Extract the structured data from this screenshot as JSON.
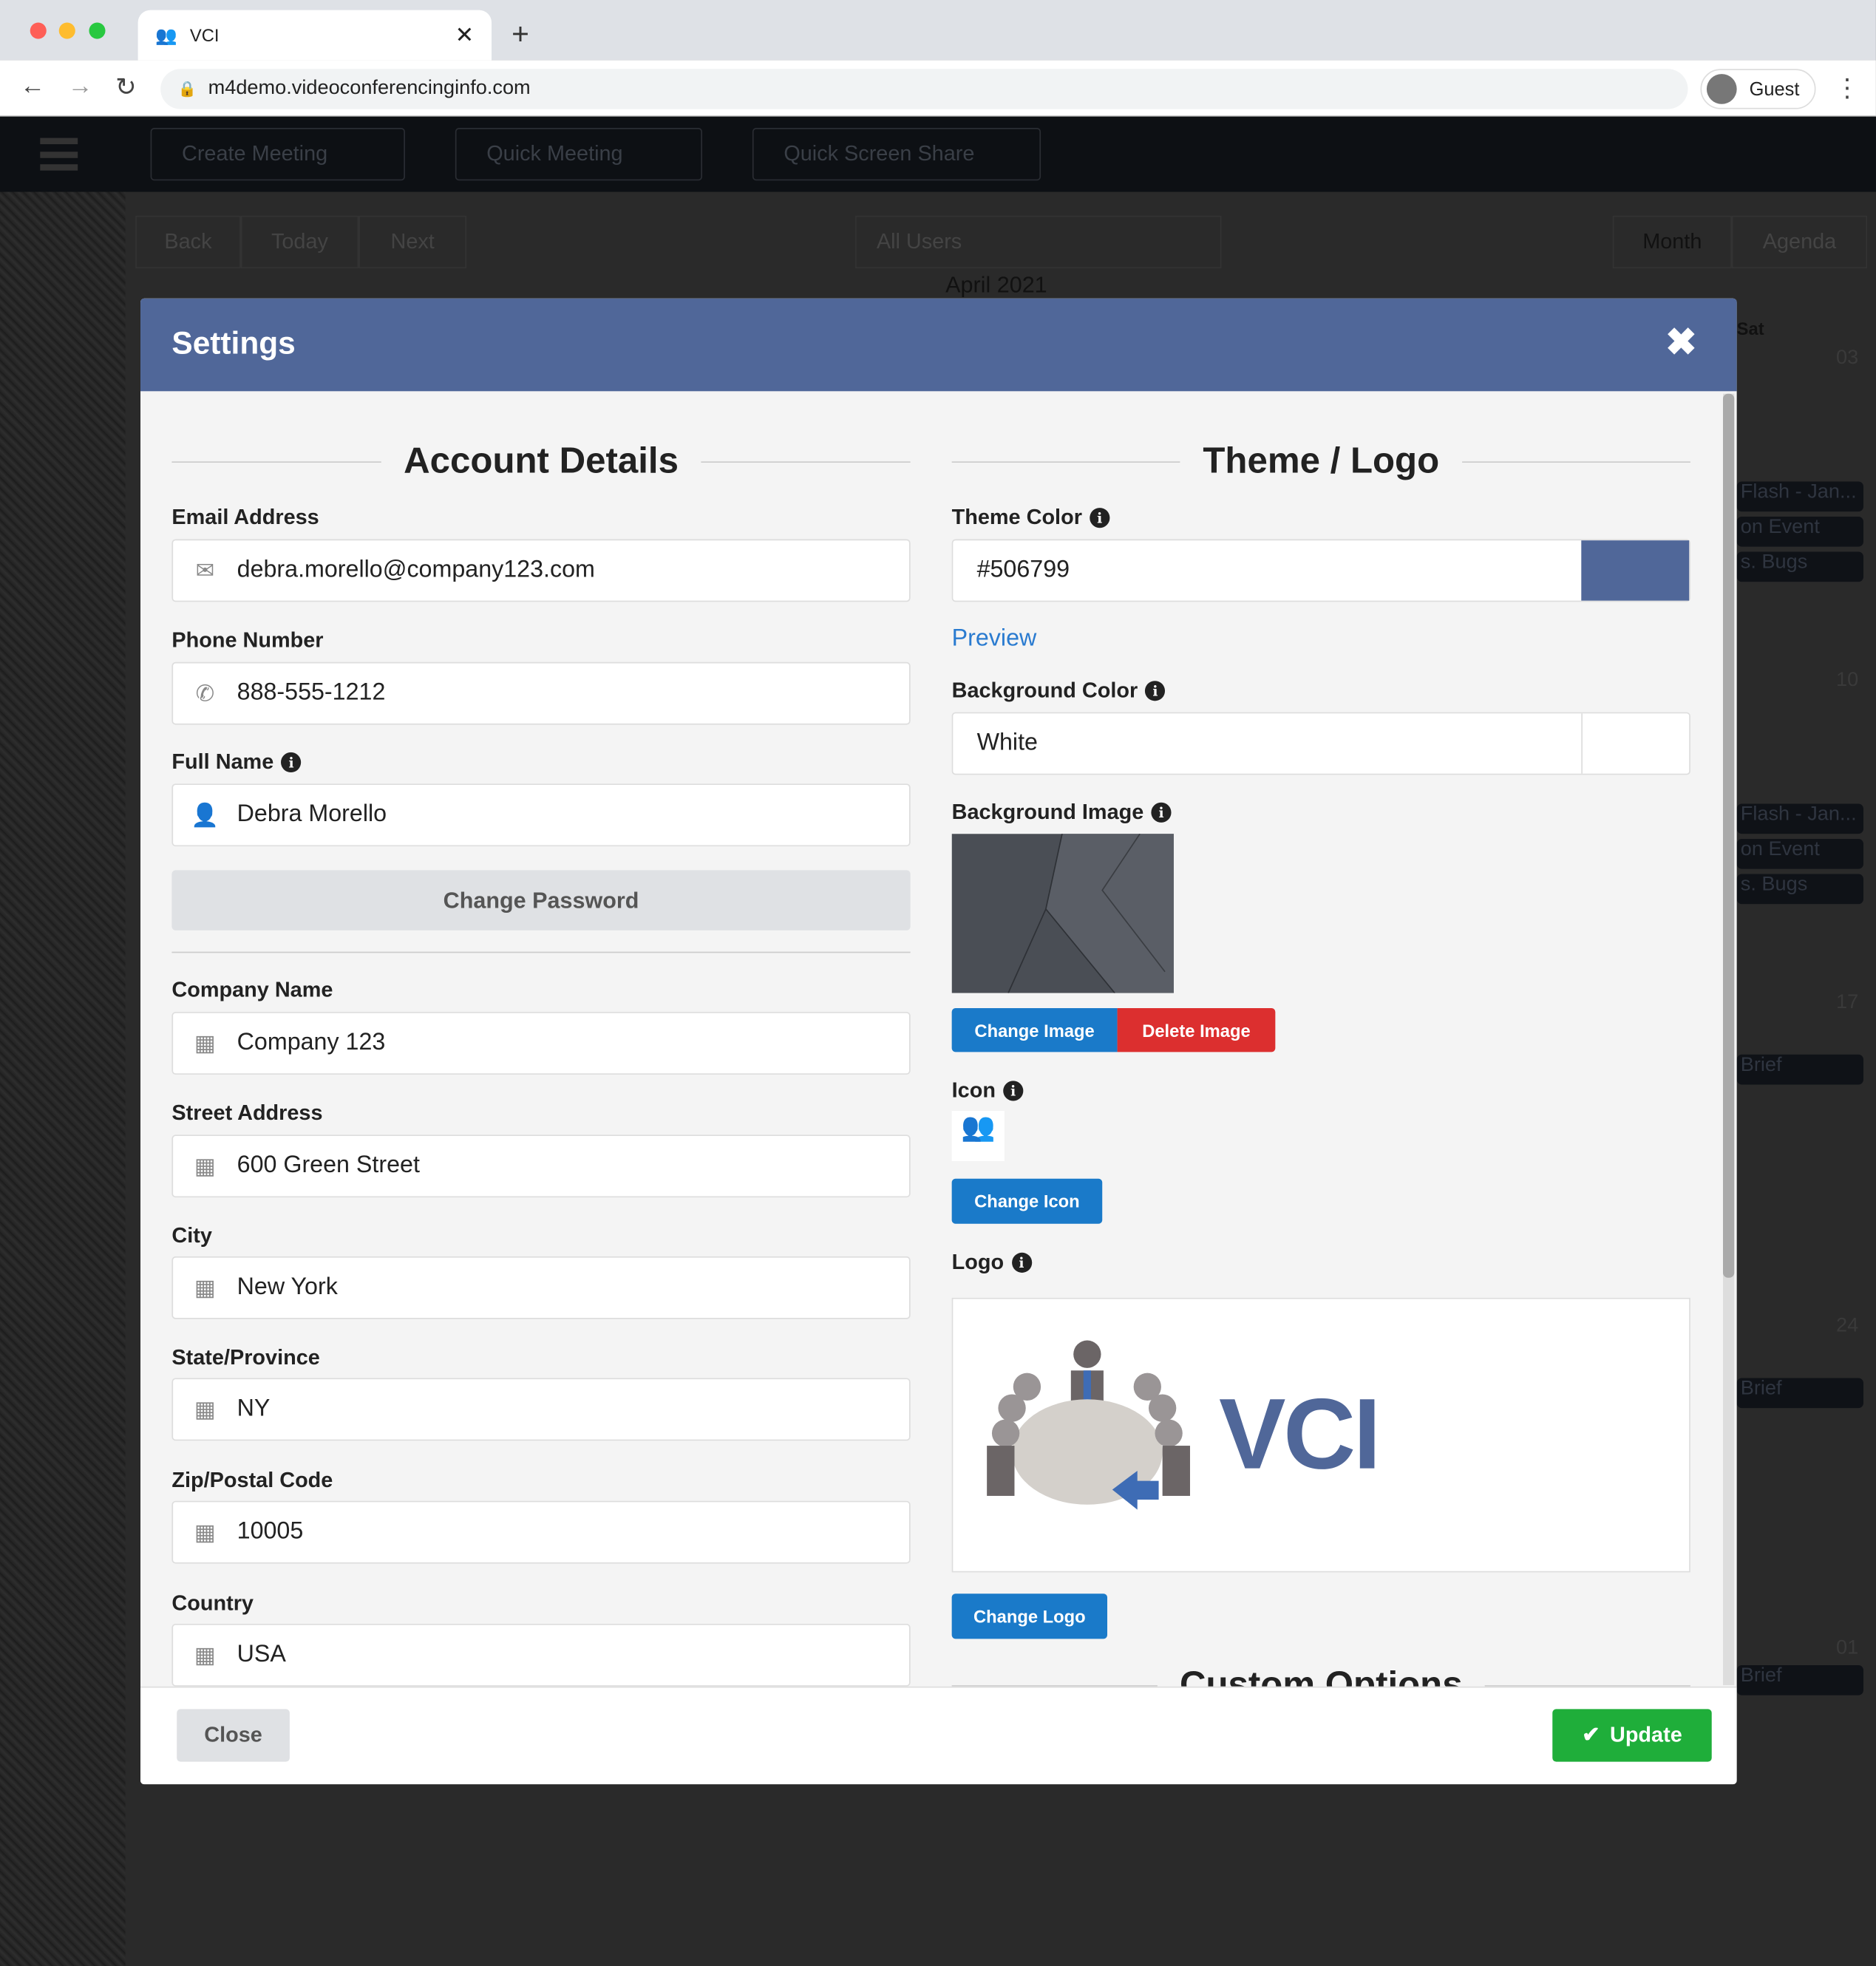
{
  "browser": {
    "tab_title": "VCI",
    "url": "m4demo.videoconferencinginfo.com",
    "profile": "Guest"
  },
  "app": {
    "nav": [
      "Create Meeting",
      "Quick Meeting",
      "Quick Screen Share"
    ],
    "cal_nav": [
      "Back",
      "Today",
      "Next"
    ],
    "user_filter": "All Users",
    "views": [
      "Month",
      "Agenda"
    ],
    "month": "April 2021",
    "day_header": "Sat",
    "days": [
      "03",
      "10",
      "17",
      "24",
      "01"
    ],
    "events": [
      "Flash - Jan...",
      "on Event",
      "s. Bugs",
      "Brief"
    ]
  },
  "modal": {
    "title": "Settings",
    "account": {
      "heading": "Account Details",
      "email_label": "Email Address",
      "email": "debra.morello@company123.com",
      "phone_label": "Phone Number",
      "phone": "888-555-1212",
      "name_label": "Full Name",
      "name": "Debra Morello",
      "change_password": "Change Password",
      "company_label": "Company Name",
      "company": "Company 123",
      "street_label": "Street Address",
      "street": "600 Green Street",
      "city_label": "City",
      "city": "New York",
      "state_label": "State/Province",
      "state": "NY",
      "zip_label": "Zip/Postal Code",
      "zip": "10005",
      "country_label": "Country",
      "country": "USA"
    },
    "theme": {
      "heading": "Theme / Logo",
      "theme_color_label": "Theme Color",
      "theme_color": "#506799",
      "preview": "Preview",
      "bg_color_label": "Background Color",
      "bg_color": "White",
      "bg_image_label": "Background Image",
      "change_image": "Change Image",
      "delete_image": "Delete Image",
      "icon_label": "Icon",
      "change_icon": "Change Icon",
      "logo_label": "Logo",
      "logo_text": "VCI",
      "change_logo": "Change Logo",
      "custom_heading": "Custom Options"
    },
    "close": "Close",
    "update": "Update"
  },
  "colors": {
    "accent": "#506799",
    "button_blue": "#1a7ac9",
    "danger": "#dc2f2f",
    "success": "#1fae3a"
  }
}
